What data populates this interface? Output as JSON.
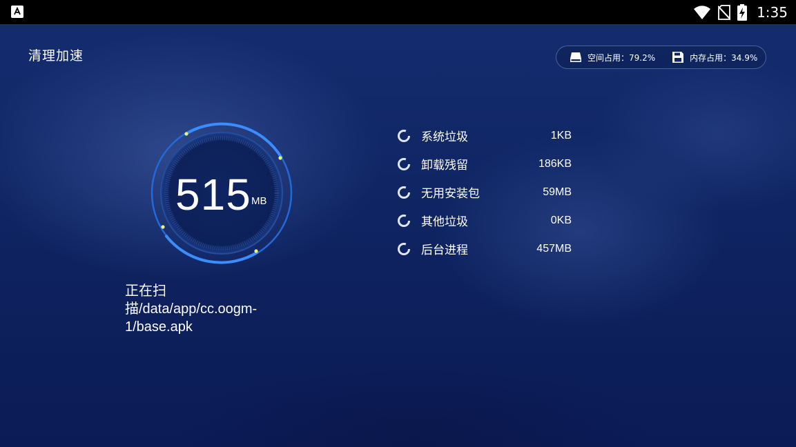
{
  "status_bar": {
    "time": "1:35",
    "icons": [
      "app-store-icon",
      "wifi-icon",
      "no-sim-icon",
      "battery-charging-icon"
    ]
  },
  "page": {
    "title": "清理加速"
  },
  "usage": {
    "disk_label": "空间占用：79.2%",
    "memory_label": "内存占用：34.9%",
    "disk_icon": "disk-icon",
    "memory_icon": "save-icon"
  },
  "gauge": {
    "value": "515",
    "unit": "MB"
  },
  "scan": {
    "status_text": "正在扫描/data/app/cc.oogm-1/base.apk"
  },
  "items": [
    {
      "label": "系统垃圾",
      "size": "1KB"
    },
    {
      "label": "卸载残留",
      "size": "186KB"
    },
    {
      "label": "无用安装包",
      "size": "59MB"
    },
    {
      "label": "其他垃圾",
      "size": "0KB"
    },
    {
      "label": "后台进程",
      "size": "457MB"
    }
  ],
  "colors": {
    "accent_blue": "#2f7cf2",
    "dot_yellow": "#e9f57a",
    "background": "#0f2462"
  }
}
